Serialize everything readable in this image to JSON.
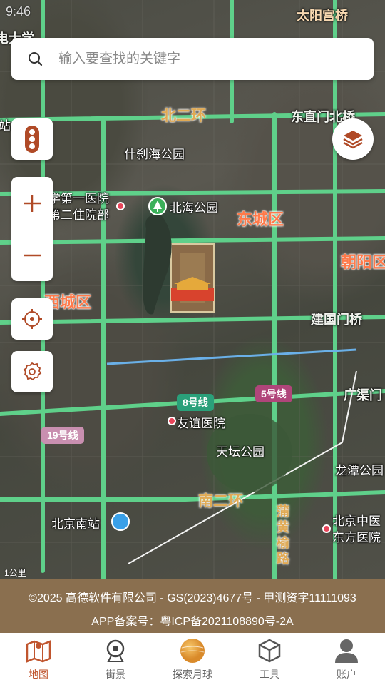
{
  "status_bar": {
    "time": "9:46"
  },
  "search": {
    "placeholder": "输入要查找的关键字"
  },
  "map": {
    "roads": {
      "beierhuan": "北二环",
      "dongzhimenbei": "东直门北桥",
      "taiyanggong": "太阳宫桥",
      "jianguomen": "建国门桥",
      "nanerhuan": "南二环",
      "guangqumen": "广渠门",
      "puhuang": "蒲黄榆路",
      "dianzi": "电大学"
    },
    "places": {
      "shichahai": "什刹海公园",
      "hospital1": "学第一医院",
      "hospital1b": "第二住院部",
      "beihai": "北海公园",
      "youyi": "友谊医院",
      "tiantan": "天坛公园",
      "longtan": "龙潭公园",
      "beijingnan": "北京南站",
      "zhongyi1": "北京中医",
      "zhongyi2": "东方医院",
      "zhan": "站"
    },
    "districts": {
      "dongcheng": "东城区",
      "xicheng": "西城区",
      "chaoyang": "朝阳区"
    },
    "lines": {
      "line8": "8号线",
      "line5": "5号线",
      "line19": "19号线"
    },
    "scale": "1公里"
  },
  "copyright": {
    "line1": "©2025 高德软件有限公司 - GS(2023)4677号 - 甲测资字11111093",
    "line2": "APP备案号：粤ICP备2021108890号-2A"
  },
  "tabs": [
    {
      "label": "地图",
      "icon": "map-icon",
      "active": true
    },
    {
      "label": "街景",
      "icon": "camera-icon",
      "active": false
    },
    {
      "label": "探索月球",
      "icon": "moon-icon",
      "active": false
    },
    {
      "label": "工具",
      "icon": "cube-icon",
      "active": false
    },
    {
      "label": "账户",
      "icon": "user-icon",
      "active": false
    }
  ],
  "colors": {
    "accent": "#c0552e",
    "road_green": "#5fd08a",
    "footer": "#8a6f4f"
  }
}
